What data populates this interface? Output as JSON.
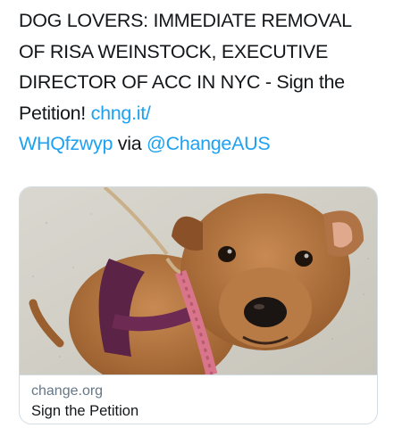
{
  "tweet": {
    "text_plain": "DOG LOVERS: IMMEDIATE REMOVAL OF RISA WEINSTOCK, EXECUTIVE DIRECTOR OF ACC IN NYC - Sign the Petition! ",
    "link_text_1": "chng.it/",
    "link_text_2": "WHQfzwyp",
    "via_text": " via ",
    "mention": "@ChangeAUS"
  },
  "card": {
    "domain": "change.org",
    "title": "Sign the Petition"
  },
  "colors": {
    "text": "#14171a",
    "link": "#1da1f2",
    "secondary": "#657786",
    "border": "#d3dde5"
  }
}
